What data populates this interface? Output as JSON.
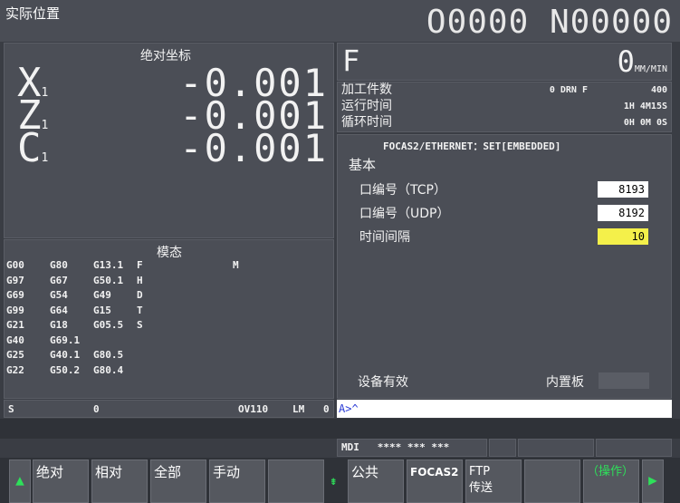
{
  "header": {
    "title": "实际位置",
    "program": "O0000 N00000"
  },
  "position": {
    "title": "绝对坐标",
    "axes": [
      {
        "name": "X",
        "sub": "1",
        "value": "-0.001"
      },
      {
        "name": "Z",
        "sub": "1",
        "value": "-0.001"
      },
      {
        "name": "C",
        "sub": "1",
        "value": "-0.001"
      }
    ]
  },
  "modal": {
    "title": "模态",
    "rows": [
      [
        "G00",
        "G80",
        "G13.1",
        "F",
        "",
        "M"
      ],
      [
        "G97",
        "G67",
        "G50.1",
        "H",
        "",
        ""
      ],
      [
        "G69",
        "G54",
        "G49",
        "D",
        "",
        ""
      ],
      [
        "G99",
        "G64",
        "G15",
        "T",
        "",
        ""
      ],
      [
        "G21",
        "G18",
        "G05.5",
        "S",
        "",
        ""
      ],
      [
        "G40",
        "G69.1",
        "",
        "",
        "",
        ""
      ],
      [
        "G25",
        "G40.1",
        "G80.5",
        "",
        "",
        ""
      ],
      [
        "G22",
        "G50.2",
        "G80.4",
        "",
        "",
        ""
      ]
    ]
  },
  "status_left": {
    "s_label": "S",
    "s_value": "0",
    "override": "OV110",
    "lm_label": "LM",
    "lm_value": "0"
  },
  "feed": {
    "label": "F",
    "value": "0",
    "unit": "MM/MIN"
  },
  "info": {
    "parts_label": "加工件数",
    "parts_extra": "0 DRN F",
    "parts_value": "400",
    "run_label": "运行时间",
    "run_value": "1H 4M15S",
    "cycle_label": "循环时间",
    "cycle_value": "0H 0M 0S"
  },
  "focas": {
    "title": "FOCAS2/ETHERNET：SET[EMBEDDED]",
    "section": "基本",
    "params": [
      {
        "label": "口编号（TCP）",
        "value": "8193",
        "highlight": false
      },
      {
        "label": "口编号（UDP）",
        "value": "8192",
        "highlight": false
      },
      {
        "label": "时间间隔",
        "value": "10",
        "highlight": true
      }
    ],
    "device_label": "设备有效",
    "device_value": "内置板"
  },
  "input_line": "A>^",
  "mode": {
    "mode": "MDI",
    "status": "**** *** ***"
  },
  "softkeys": [
    {
      "label": "绝对"
    },
    {
      "label": "相对"
    },
    {
      "label": "全部"
    },
    {
      "label": "手动"
    },
    {
      "label": ""
    },
    {
      "label": "公共"
    },
    {
      "label": "FOCAS2"
    },
    {
      "label": "FTP\n传送"
    },
    {
      "label": ""
    },
    {
      "label": "（操作）"
    }
  ],
  "colors": {
    "highlight": "#f4f04a",
    "input_text": "#2a3bd6",
    "arrow": "#2ee05a"
  }
}
